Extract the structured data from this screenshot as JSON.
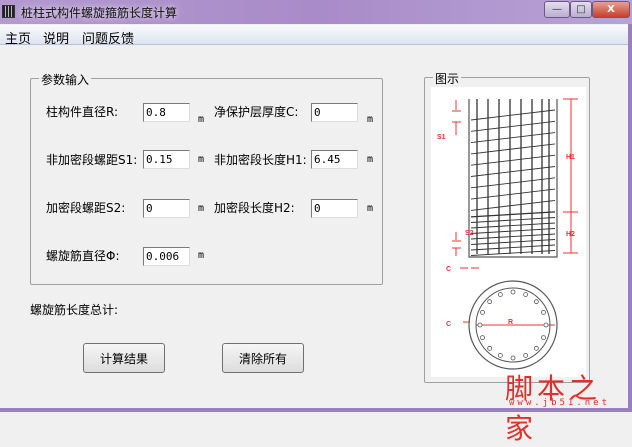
{
  "window": {
    "title": "桩柱式构件螺旋箍筋长度计算",
    "minimize": "—",
    "maximize": "□",
    "close": "X"
  },
  "menu": [
    "主页",
    "说明",
    "问题反馈"
  ],
  "params": {
    "legend": "参数输入",
    "fields": [
      {
        "label": "柱构件直径R:",
        "value": "0.8",
        "unit": "m"
      },
      {
        "label": "净保护层厚度C:",
        "value": "0",
        "unit": "m"
      },
      {
        "label": "非加密段螺距S1:",
        "value": "0.15",
        "unit": "m"
      },
      {
        "label": "非加密段长度H1:",
        "value": "6.45",
        "unit": "m"
      },
      {
        "label": "加密段螺距S2:",
        "value": "0",
        "unit": "m"
      },
      {
        "label": "加密段长度H2:",
        "value": "0",
        "unit": "m"
      },
      {
        "label": "螺旋筋直径Φ:",
        "value": "0.006",
        "unit": "m"
      }
    ]
  },
  "total_label": "螺旋筋长度总计:",
  "buttons": {
    "calculate": "计算结果",
    "clear": "清除所有"
  },
  "figure": {
    "legend": "图示",
    "labels": {
      "s1": "S1",
      "s2": "S2",
      "h1": "H1",
      "h2": "H2",
      "c": "C",
      "r": "R"
    }
  },
  "watermark": {
    "main": "脚本之家",
    "url": "www.jb51.net"
  }
}
